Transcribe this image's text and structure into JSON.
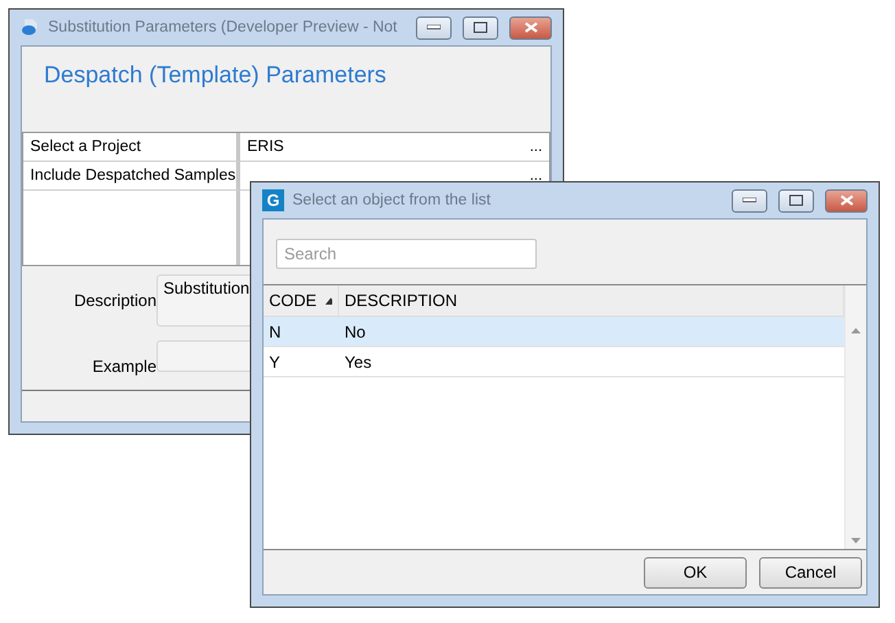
{
  "back_window": {
    "title": "Substitution Parameters (Developer Preview - Not",
    "heading": "Despatch (Template) Parameters",
    "parameters": [
      {
        "label": "Select a Project",
        "value": "ERIS",
        "button": "..."
      },
      {
        "label": "Include Despatched Samples",
        "button": "..."
      }
    ],
    "fields": [
      {
        "label": "Description",
        "value": "Substitution",
        "kind": "multiline"
      },
      {
        "label": "Example",
        "kind": "single"
      }
    ]
  },
  "dialog": {
    "title": "Select an object from the list",
    "app_letter": "G",
    "search": {
      "placeholder": "Search"
    },
    "columns": [
      {
        "label": "CODE",
        "sorted": true
      },
      {
        "label": "DESCRIPTION",
        "sorted": false
      }
    ],
    "rows": [
      {
        "code": "N",
        "description": "No",
        "selected": true
      },
      {
        "code": "Y",
        "description": "Yes",
        "selected": false
      }
    ],
    "buttons": [
      "OK",
      "Cancel"
    ]
  }
}
